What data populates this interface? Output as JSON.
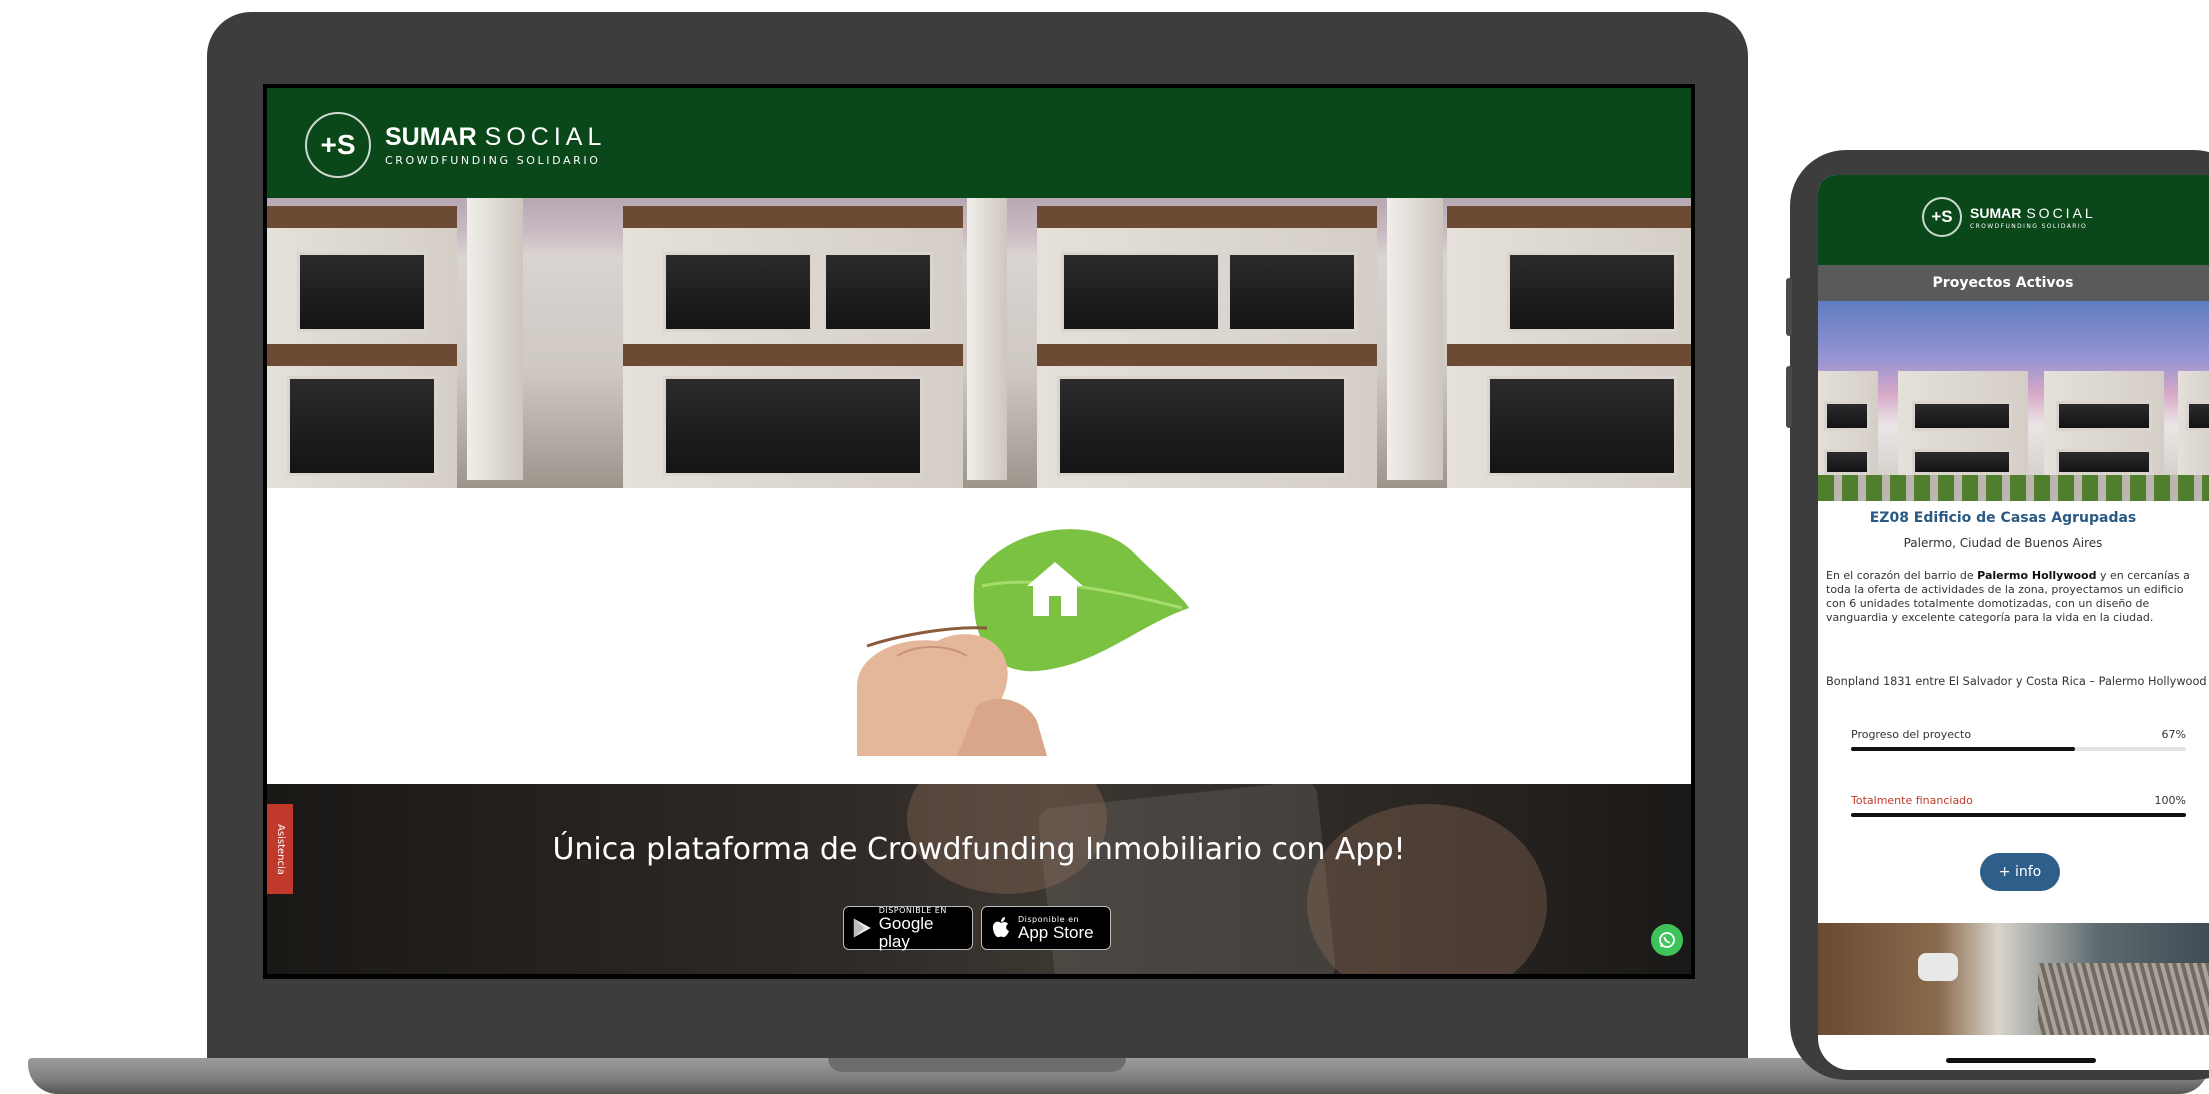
{
  "brand": {
    "logo_mark": "+S",
    "name_bold": "SUMAR",
    "name_thin": "SOCIAL",
    "tagline": "CROWDFUNDING SOLIDARIO",
    "primary_color": "#0a4719"
  },
  "laptop": {
    "banner_title": "Única plataforma de Crowdfunding Inmobiliario con App!",
    "google_play": {
      "small": "DISPONIBLE EN",
      "big": "Google play"
    },
    "app_store": {
      "small": "Disponible en",
      "big": "App Store"
    },
    "assistance_tab": "Asistencia",
    "whatsapp_icon": "whatsapp-icon"
  },
  "phone": {
    "section_title": "Proyectos Activos",
    "project": {
      "title": "EZ08 Edificio de Casas Agrupadas",
      "location": "Palermo, Ciudad de Buenos Aires",
      "description_pre": "En el corazón del barrio de ",
      "description_bold": "Palermo Hollywood",
      "description_post": " y en cercanías a toda la oferta de actividades de la zona, proyectamos un edificio con 6 unidades totalmente domotizadas, con un diseño de vanguardia y excelente categoría para la vida en la ciudad.",
      "address": "Bonpland 1831 entre El Salvador y Costa Rica – Palermo Hollywood",
      "progress_label": "Progreso del proyecto",
      "progress_value": "67%",
      "progress_fraction": 0.67,
      "funded_label": "Totalmente financiado",
      "funded_value": "100%",
      "funded_fraction": 1.0,
      "funded_color": "#c0392b",
      "info_button": "+ info"
    }
  }
}
